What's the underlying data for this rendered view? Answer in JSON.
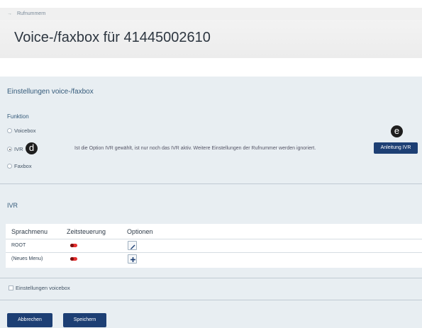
{
  "breadcrumb": {
    "arrow": "→",
    "item": "Rufnummern"
  },
  "page": {
    "title": "Voice-/faxbox für 41445002610"
  },
  "settings": {
    "title": "Einstellungen voice-/faxbox",
    "funktion_label": "Funktion",
    "options": [
      {
        "label": "Voicebox",
        "selected": false
      },
      {
        "label": "IVR",
        "selected": true
      },
      {
        "label": "Faxbox",
        "selected": false
      }
    ],
    "ivr_info": "Ist die Option IVR gewählt, ist nur noch das IVR aktiv. Weitere Einstellungen der Rufnummer werden ignoriert.",
    "guide_button": "Anleitung IVR"
  },
  "markers": {
    "d": "d",
    "e": "e"
  },
  "ivr": {
    "title": "IVR",
    "columns": [
      "Sprachmenu",
      "Zeitsteuerung",
      "Optionen"
    ],
    "rows": [
      {
        "name": "ROOT",
        "zeitsteuerung": "off",
        "option_icon": "pencil-icon"
      },
      {
        "name": "(Neues Menu)",
        "zeitsteuerung": "off",
        "option_icon": "plus-icon"
      }
    ]
  },
  "voicebox_settings": {
    "label": "Einstellungen voicebox",
    "checked": false
  },
  "actions": {
    "cancel": "Abbrechen",
    "save": "Speichern"
  },
  "colors": {
    "button": "#1d3f74",
    "toggle": "#e53030",
    "heading": "#345a7a"
  }
}
